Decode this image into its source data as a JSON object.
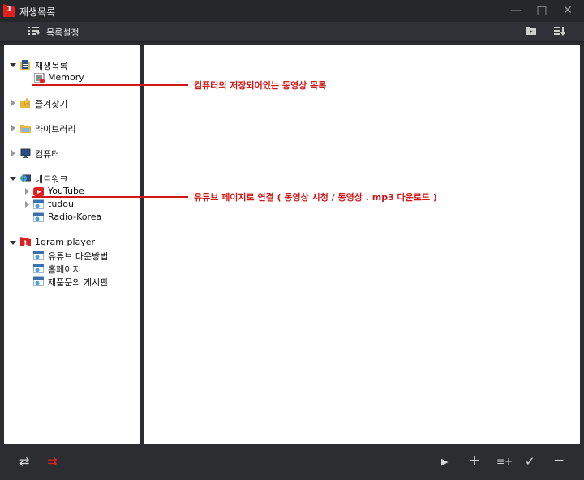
{
  "window": {
    "logo_text": "1",
    "title": "재생목록",
    "minimize": "—",
    "maximize": "□",
    "close": "✕"
  },
  "toolbar": {
    "list_settings": "목록설정"
  },
  "tree": {
    "playlist": {
      "label": "재생목록",
      "children": {
        "memory": "Memory"
      }
    },
    "favorites": {
      "label": "즐겨찾기"
    },
    "library": {
      "label": "라이브러리"
    },
    "computer": {
      "label": "컴퓨터"
    },
    "network": {
      "label": "네트워크",
      "children": {
        "youtube": "YouTube",
        "tudou": "tudou",
        "radio_korea": "Radio-Korea"
      }
    },
    "player": {
      "label": "1gram player",
      "children": {
        "youtube_download": "유튜브 다운방법",
        "homepage": "홈페이지",
        "inquiry": "제품문의 게시판"
      }
    }
  },
  "annotations": {
    "memory_note": "컴퓨터의 저장되어있는 동영상 목록",
    "youtube_note": "유튜브 페이지로 연결 ( 동영상 시청 / 동영상 . mp3 다운로드 )",
    "color": "#d01818"
  },
  "bottom": {
    "repeat": "⇄",
    "shuffle": "⇉",
    "play": "▶",
    "add": "+",
    "add_list": "≡+",
    "check": "✓",
    "remove": "−"
  },
  "colors": {
    "accent": "#e02020",
    "background": "#2b2d31",
    "panel": "#ffffff"
  }
}
